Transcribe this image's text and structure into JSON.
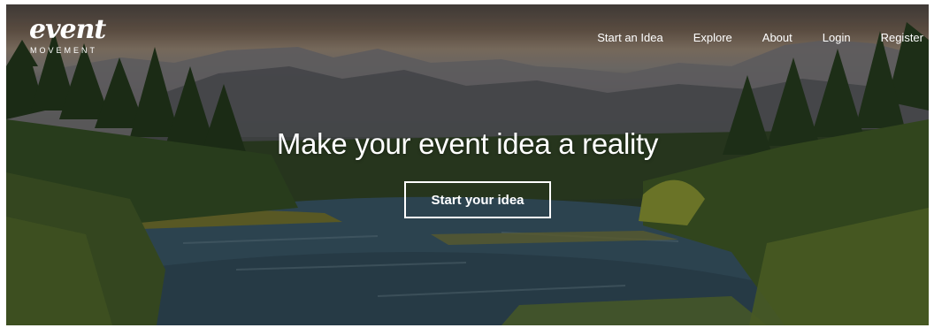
{
  "brand": {
    "word": "event",
    "sub": "MOVEMENT"
  },
  "nav": {
    "start_idea": "Start an Idea",
    "explore": "Explore",
    "about": "About",
    "login": "Login",
    "register": "Register"
  },
  "hero": {
    "headline": "Make your event idea a reality",
    "cta_label": "Start your idea"
  }
}
